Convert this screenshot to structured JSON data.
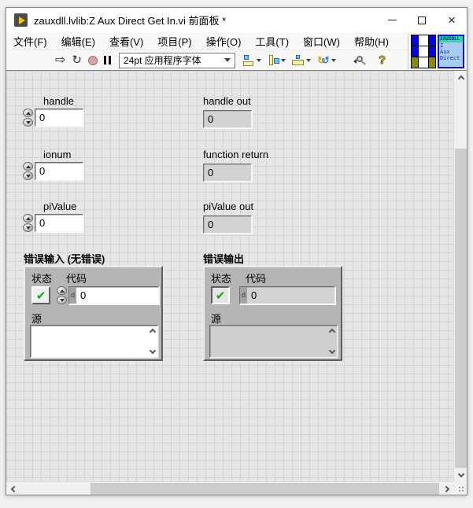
{
  "window": {
    "title": "zauxdll.lvlib:Z Aux Direct Get In.vi 前面板 *",
    "close_glyph": "×"
  },
  "menus": [
    "文件(F)",
    "编辑(E)",
    "查看(V)",
    "项目(P)",
    "操作(O)",
    "工具(T)",
    "窗口(W)",
    "帮助(H)"
  ],
  "toolbar": {
    "font_selector": "24pt 应用程序字体",
    "run_glyph": "⇨",
    "runcont_glyph": "↻",
    "help_glyph": "?",
    "reorder_y": "↻",
    "reorder_b": "↺"
  },
  "vi_icon": {
    "band": "ZAUXDLL",
    "line2": "Z",
    "line3": "Aux",
    "line4": "Direct"
  },
  "controls": {
    "handle": {
      "label": "handle",
      "value": "0"
    },
    "handle_out": {
      "label": "handle out",
      "value": "0"
    },
    "ionum": {
      "label": "ionum",
      "value": "0"
    },
    "function_return": {
      "label": "function return",
      "value": "0"
    },
    "pivalue": {
      "label": "piValue",
      "value": "0"
    },
    "pivalue_out": {
      "label": "piValue out",
      "value": "0"
    },
    "error_in": {
      "label": "错误输入 (无错误)",
      "status_label": "状态",
      "code_label": "代码",
      "source_label": "源",
      "status_check": "✔",
      "code_radix": "d",
      "code_value": "0",
      "source_value": ""
    },
    "error_out": {
      "label": "错误输出",
      "status_label": "状态",
      "code_label": "代码",
      "source_label": "源",
      "status_check": "✔",
      "code_radix": "d",
      "code_value": "0",
      "source_value": ""
    }
  }
}
